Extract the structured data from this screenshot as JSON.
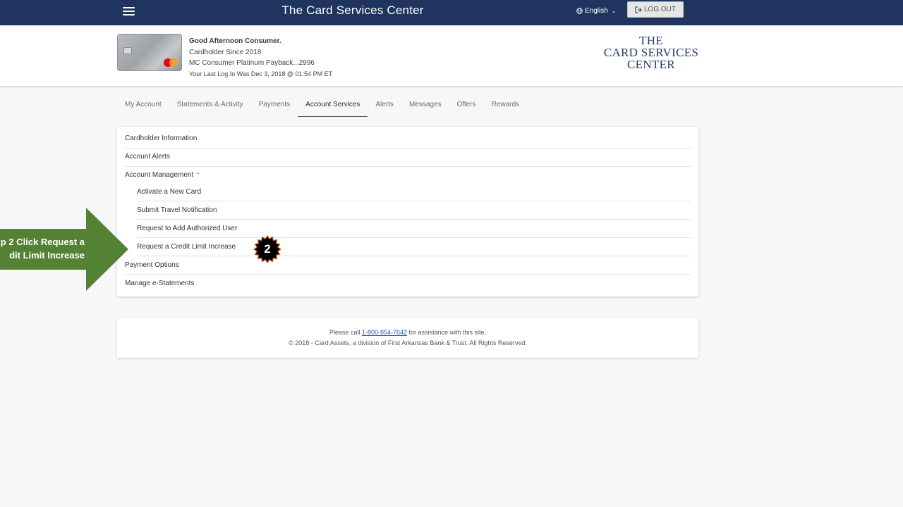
{
  "topbar": {
    "title": "The Card Services Center",
    "language": "English",
    "logout_label": "LOG OUT"
  },
  "account_header": {
    "greeting": "Good Afternoon Consumer.",
    "cardholder_since": "Cardholder Since 2018",
    "card_name": "MC Consumer Platinum Payback...2996",
    "last_login": "Your Last Log In Was Dec 3, 2018 @ 01:54 PM ET",
    "logo_lines": [
      "THE",
      "CARD SERVICES",
      "CENTER"
    ]
  },
  "tabs": [
    {
      "label": "My Account",
      "active": false
    },
    {
      "label": "Statements & Activity",
      "active": false
    },
    {
      "label": "Payments",
      "active": false
    },
    {
      "label": "Account Services",
      "active": true
    },
    {
      "label": "Alerts",
      "active": false
    },
    {
      "label": "Messages",
      "active": false
    },
    {
      "label": "Offers",
      "active": false
    },
    {
      "label": "Rewards",
      "active": false
    }
  ],
  "services_menu": {
    "cardholder_information": "Cardholder Information",
    "account_alerts": "Account Alerts",
    "account_management": "Account Management",
    "account_management_items": [
      "Activate a New Card",
      "Submit Travel Notification",
      "Request to Add Authorized User",
      "Request a Credit Limit Increase"
    ],
    "payment_options": "Payment Options",
    "manage_estatements": "Manage e-Statements"
  },
  "footer": {
    "assist_prefix": "Please call ",
    "phone": "1-800-854-7642",
    "assist_suffix": " for assistance with this site.",
    "copyright": "© 2018 - Card Assets, a division of First Arkansas Bank & Trust. All Rights Reserved."
  },
  "annotation": {
    "arrow_line1": "p 2 Click Request a",
    "arrow_line2": "dit Limit Increase",
    "step_number": "2"
  },
  "colors": {
    "topbar": "#1f3560",
    "arrow": "#548235",
    "badge": "#000000",
    "badge_border": "#c55a11",
    "link": "#2b63b6"
  },
  "icons": {
    "menu": "hamburger-icon",
    "language": "globe-icon",
    "logout": "sign-out-icon",
    "card_brand": "mastercard-icon"
  }
}
